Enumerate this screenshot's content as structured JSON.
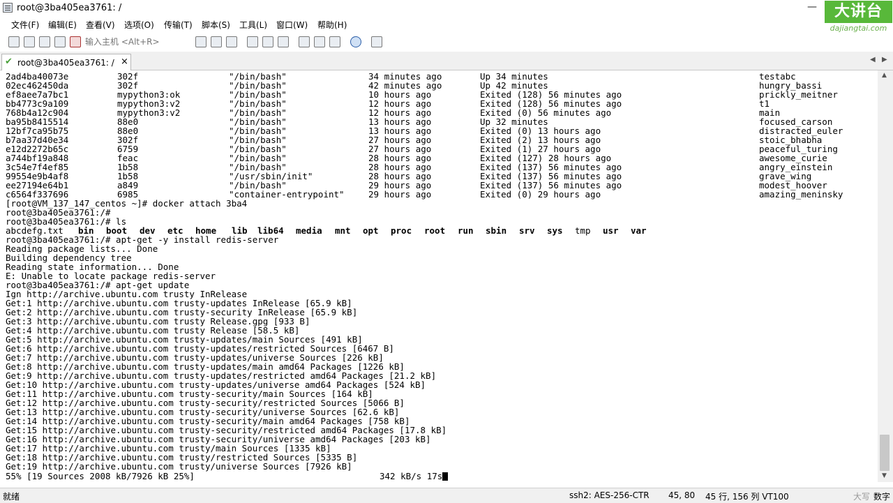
{
  "window": {
    "title": "root@3ba405ea3761: /",
    "minimize": "—",
    "logo_text": "大讲台",
    "logo_site": "dajiangtai.com"
  },
  "menu": [
    "文件(F)",
    "编辑(E)",
    "查看(V)",
    "选项(O)",
    "传输(T)",
    "脚本(S)",
    "工具(L)",
    "窗口(W)",
    "帮助(H)"
  ],
  "toolbar": {
    "host_placeholder": "输入主机 <Alt+R>"
  },
  "tab": {
    "label": "root@3ba405ea3761: /",
    "close": "×",
    "nav_left": "◀",
    "nav_right": "▶"
  },
  "containers": [
    {
      "id": "2ad4ba40073e",
      "image": "302f",
      "command": "\"/bin/bash\"",
      "created": "34 minutes ago",
      "status": "Up 34 minutes",
      "name": "testabc"
    },
    {
      "id": "02ec462450da",
      "image": "302f",
      "command": "\"/bin/bash\"",
      "created": "42 minutes ago",
      "status": "Up 42 minutes",
      "name": "hungry_bassi"
    },
    {
      "id": "ef8aee7a7bc1",
      "image": "mypython3:ok",
      "command": "\"/bin/bash\"",
      "created": "10 hours ago",
      "status": "Exited (128) 56 minutes ago",
      "name": "prickly_meitner"
    },
    {
      "id": "bb4773c9a109",
      "image": "mypython3:v2",
      "command": "\"/bin/bash\"",
      "created": "12 hours ago",
      "status": "Exited (128) 56 minutes ago",
      "name": "t1"
    },
    {
      "id": "768b4a12c904",
      "image": "mypython3:v2",
      "command": "\"/bin/bash\"",
      "created": "12 hours ago",
      "status": "Exited (0) 56 minutes ago",
      "name": "main"
    },
    {
      "id": "ba95b8415514",
      "image": "88e0",
      "command": "\"/bin/bash\"",
      "created": "13 hours ago",
      "status": "Up 32 minutes",
      "name": "focused_carson"
    },
    {
      "id": "12bf7ca95b75",
      "image": "88e0",
      "command": "\"/bin/bash\"",
      "created": "13 hours ago",
      "status": "Exited (0) 13 hours ago",
      "name": "distracted_euler"
    },
    {
      "id": "b7aa37d40e34",
      "image": "302f",
      "command": "\"/bin/bash\"",
      "created": "27 hours ago",
      "status": "Exited (2) 13 hours ago",
      "name": "stoic_bhabha"
    },
    {
      "id": "e12d2272b65c",
      "image": "6759",
      "command": "\"/bin/bash\"",
      "created": "27 hours ago",
      "status": "Exited (1) 27 hours ago",
      "name": "peaceful_turing"
    },
    {
      "id": "a744bf19a848",
      "image": "feac",
      "command": "\"/bin/bash\"",
      "created": "28 hours ago",
      "status": "Exited (127) 28 hours ago",
      "name": "awesome_curie"
    },
    {
      "id": "3c54e7f4ef85",
      "image": "1b58",
      "command": "\"/bin/bash\"",
      "created": "28 hours ago",
      "status": "Exited (137) 56 minutes ago",
      "name": "angry_einstein"
    },
    {
      "id": "99554e9b4af8",
      "image": "1b58",
      "command": "\"/usr/sbin/init\"",
      "created": "28 hours ago",
      "status": "Exited (137) 56 minutes ago",
      "name": "grave_wing"
    },
    {
      "id": "ee27194e64b1",
      "image": "a849",
      "command": "\"/bin/bash\"",
      "created": "29 hours ago",
      "status": "Exited (137) 56 minutes ago",
      "name": "modest_hoover"
    },
    {
      "id": "c6564f337696",
      "image": "6985",
      "command": "\"container-entrypoint\"",
      "created": "29 hours ago",
      "status": "Exited (0) 29 hours ago",
      "name": "amazing_meninsky"
    }
  ],
  "lines_after": [
    "[root@VM_137_147_centos ~]# docker attach 3ba4",
    "root@3ba405ea3761:/#",
    "root@3ba405ea3761:/# ls"
  ],
  "ls_output": [
    {
      "text": "abcdefg.txt",
      "bold": false
    },
    {
      "text": "bin",
      "bold": true
    },
    {
      "text": "boot",
      "bold": true
    },
    {
      "text": "dev",
      "bold": true
    },
    {
      "text": "etc",
      "bold": true
    },
    {
      "text": "home",
      "bold": true
    },
    {
      "text": "lib",
      "bold": true
    },
    {
      "text": "lib64",
      "bold": true
    },
    {
      "text": "media",
      "bold": true
    },
    {
      "text": "mnt",
      "bold": true
    },
    {
      "text": "opt",
      "bold": true
    },
    {
      "text": "proc",
      "bold": true
    },
    {
      "text": "root",
      "bold": true
    },
    {
      "text": "run",
      "bold": true
    },
    {
      "text": "sbin",
      "bold": true
    },
    {
      "text": "srv",
      "bold": true
    },
    {
      "text": "sys",
      "bold": true
    },
    {
      "text": "tmp",
      "bold": false
    },
    {
      "text": "usr",
      "bold": true
    },
    {
      "text": "var",
      "bold": true
    }
  ],
  "lines_tail": [
    "root@3ba405ea3761:/# apt-get -y install redis-server",
    "Reading package lists... Done",
    "Building dependency tree",
    "Reading state information... Done",
    "E: Unable to locate package redis-server",
    "root@3ba405ea3761:/# apt-get update",
    "Ign http://archive.ubuntu.com trusty InRelease",
    "Get:1 http://archive.ubuntu.com trusty-updates InRelease [65.9 kB]",
    "Get:2 http://archive.ubuntu.com trusty-security InRelease [65.9 kB]",
    "Get:3 http://archive.ubuntu.com trusty Release.gpg [933 B]",
    "Get:4 http://archive.ubuntu.com trusty Release [58.5 kB]",
    "Get:5 http://archive.ubuntu.com trusty-updates/main Sources [491 kB]",
    "Get:6 http://archive.ubuntu.com trusty-updates/restricted Sources [6467 B]",
    "Get:7 http://archive.ubuntu.com trusty-updates/universe Sources [226 kB]",
    "Get:8 http://archive.ubuntu.com trusty-updates/main amd64 Packages [1226 kB]",
    "Get:9 http://archive.ubuntu.com trusty-updates/restricted amd64 Packages [21.2 kB]",
    "Get:10 http://archive.ubuntu.com trusty-updates/universe amd64 Packages [524 kB]",
    "Get:11 http://archive.ubuntu.com trusty-security/main Sources [164 kB]",
    "Get:12 http://archive.ubuntu.com trusty-security/restricted Sources [5066 B]",
    "Get:13 http://archive.ubuntu.com trusty-security/universe Sources [62.6 kB]",
    "Get:14 http://archive.ubuntu.com trusty-security/main amd64 Packages [758 kB]",
    "Get:15 http://archive.ubuntu.com trusty-security/restricted amd64 Packages [17.8 kB]",
    "Get:16 http://archive.ubuntu.com trusty-security/universe amd64 Packages [203 kB]",
    "Get:17 http://archive.ubuntu.com trusty/main Sources [1335 kB]",
    "Get:18 http://archive.ubuntu.com trusty/restricted Sources [5335 B]",
    "Get:19 http://archive.ubuntu.com trusty/universe Sources [7926 kB]"
  ],
  "progress_line": {
    "left": "55% [19 Sources 2008 kB/7926 kB 25%]",
    "right": "342 kB/s 17s"
  },
  "scrollbar": {
    "up": "▲",
    "down": "▼"
  },
  "status": {
    "ready": "就绪",
    "cipher": "ssh2: AES-256-CTR",
    "cursor_pos": "45, 80",
    "size": "45 行, 156 列 VT100",
    "caps": "大写",
    "num": "数字"
  },
  "colors": {
    "logo_green": "#58b83a",
    "cursor": "#000000"
  }
}
